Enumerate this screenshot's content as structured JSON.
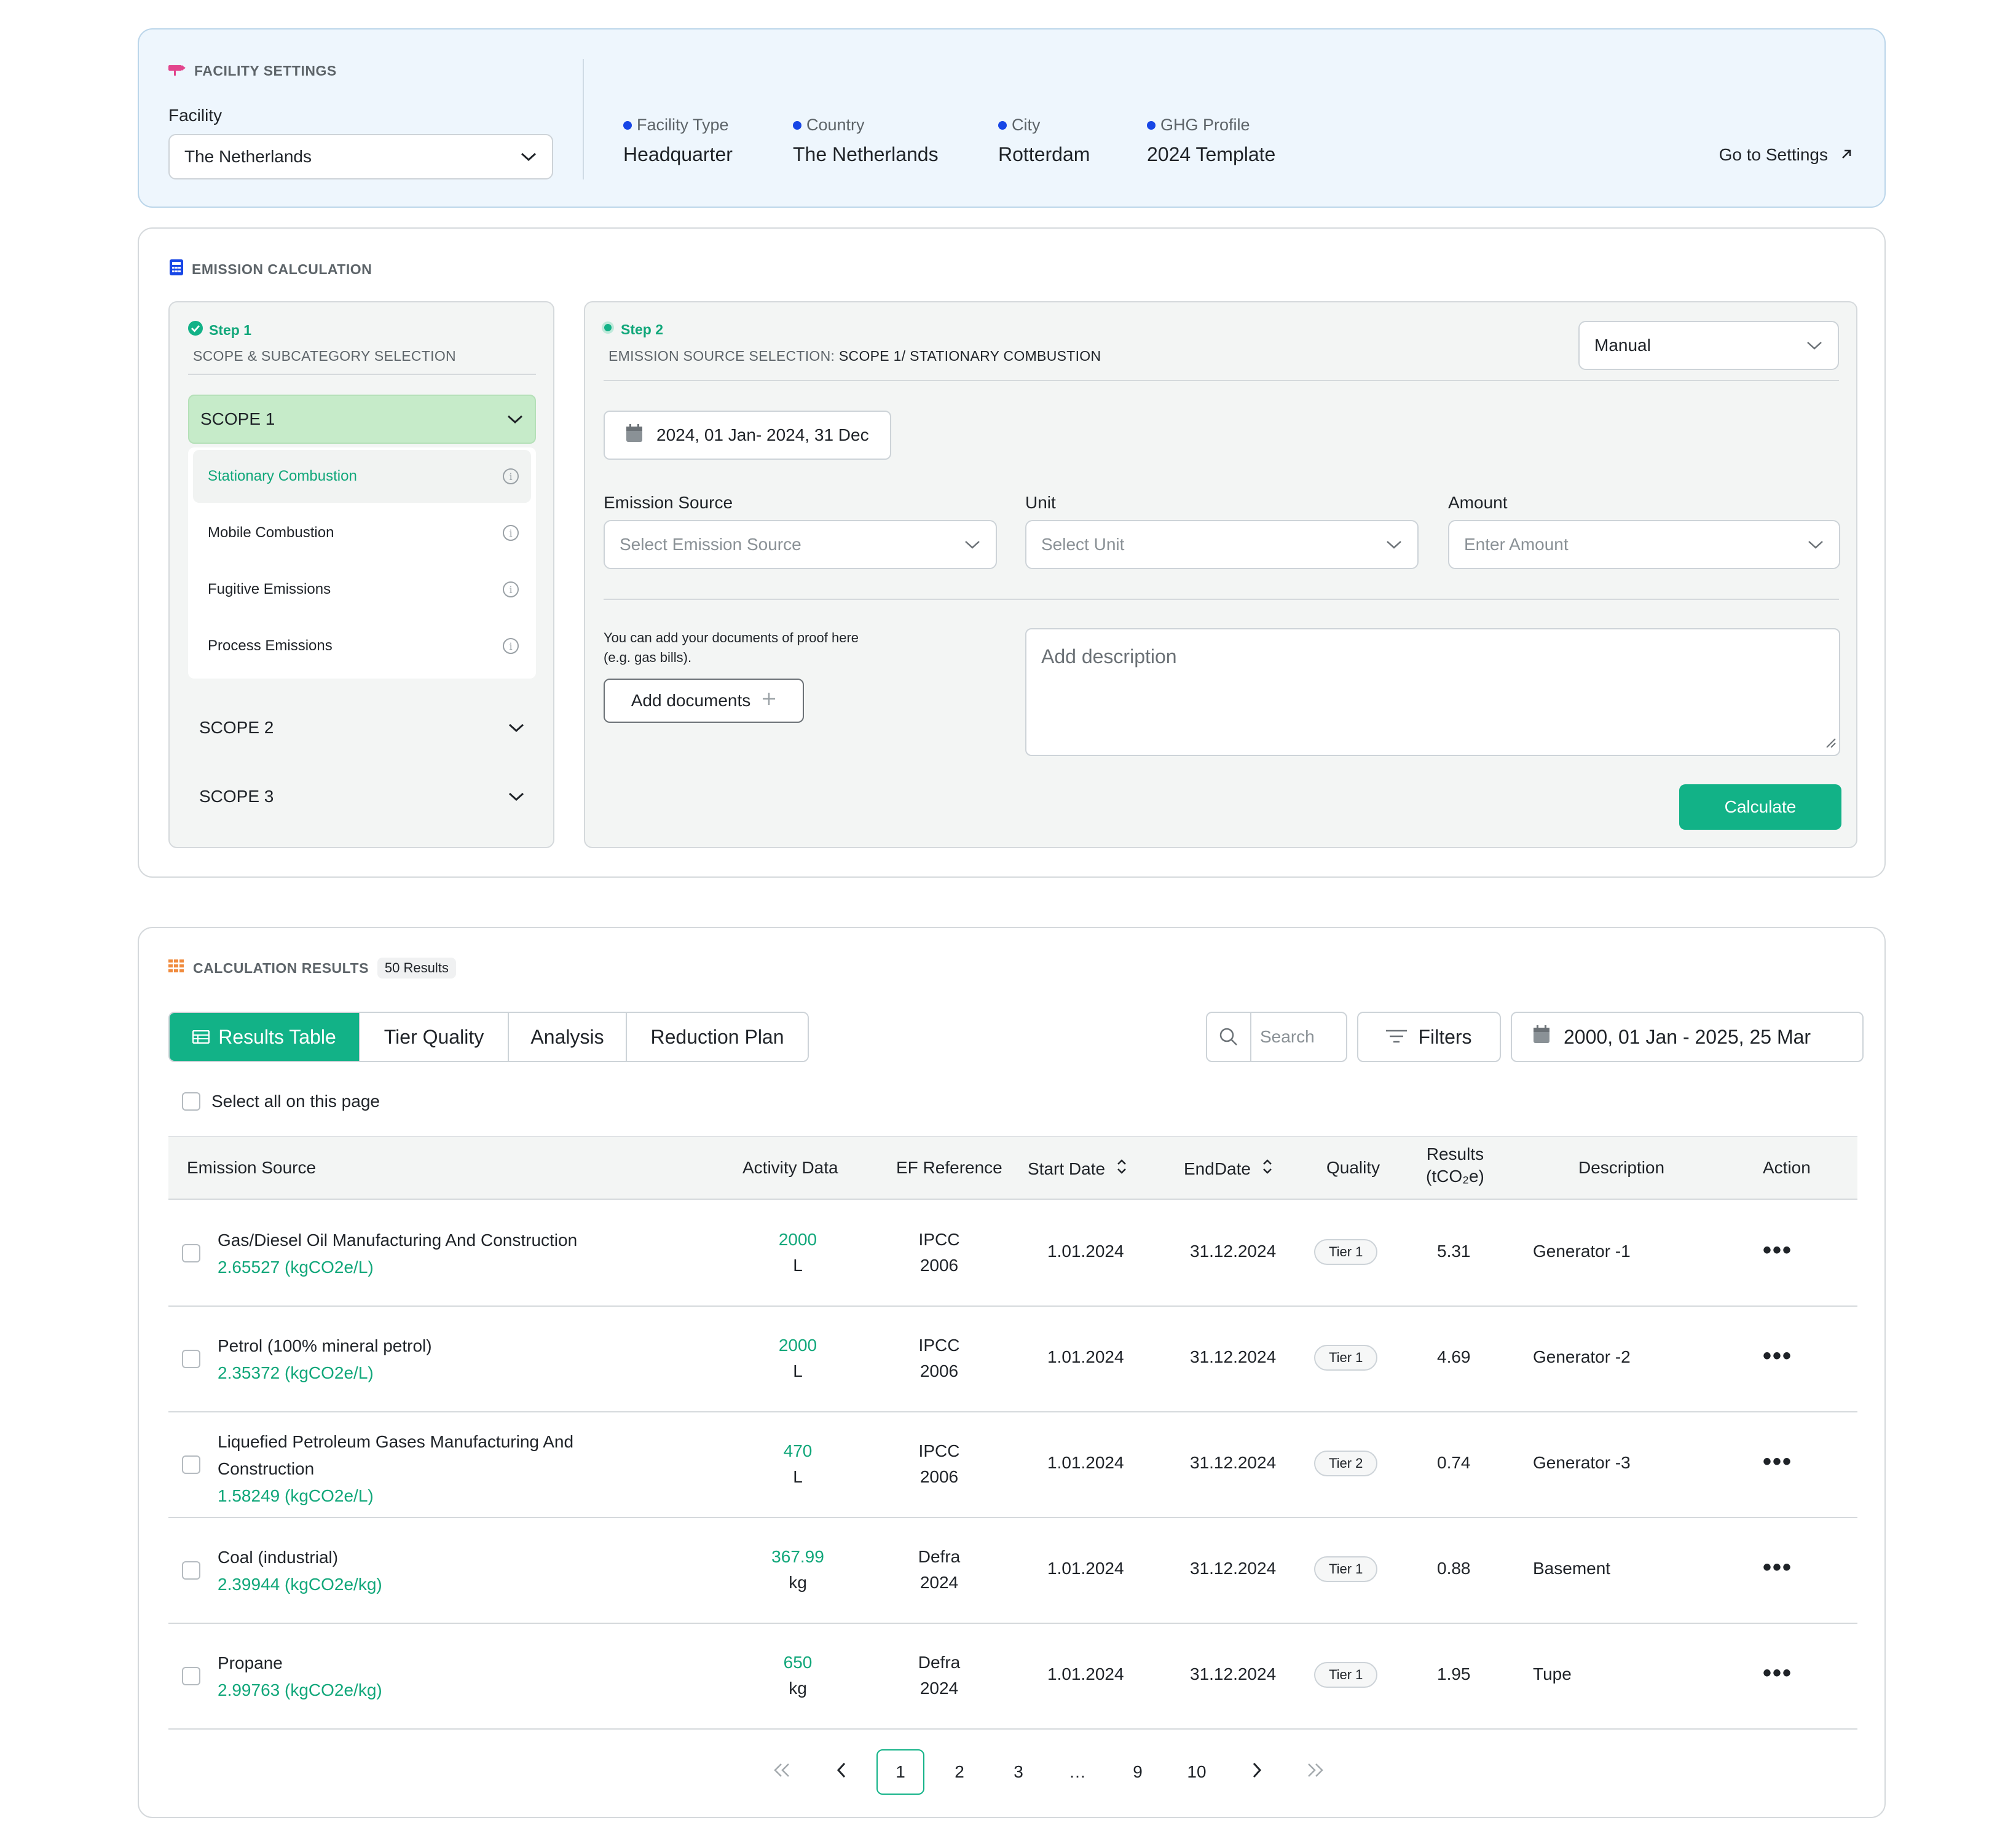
{
  "facility": {
    "section_title": "FACILITY SETTINGS",
    "facility_label": "Facility",
    "facility_value": "The Netherlands",
    "info": [
      {
        "label": "Facility Type",
        "value": "Headquarter"
      },
      {
        "label": "Country",
        "value": "The Netherlands"
      },
      {
        "label": "City",
        "value": "Rotterdam"
      },
      {
        "label": "GHG Profile",
        "value": "2024 Template"
      }
    ],
    "go_settings": "Go to Settings"
  },
  "calculation": {
    "section_title": "EMISSION CALCULATION",
    "step1": {
      "title": "Step 1",
      "subtitle": "SCOPE & SUBCATEGORY SELECTION",
      "scopes": [
        "SCOPE 1",
        "SCOPE 2",
        "SCOPE 3"
      ],
      "subcategories": [
        "Stationary Combustion",
        "Mobile Combustion",
        "Fugitive Emissions",
        "Process Emissions"
      ]
    },
    "step2": {
      "title": "Step 2",
      "subtitle_prefix": "EMISSION SOURCE SELECTION:",
      "subtitle_value": "SCOPE 1/ STATIONARY COMBUSTION",
      "mode": "Manual",
      "date_range": "2024, 01 Jan- 2024, 31 Dec",
      "emission_source_label": "Emission Source",
      "emission_source_placeholder": "Select Emission Source",
      "unit_label": "Unit",
      "unit_placeholder": "Select Unit",
      "amount_label": "Amount",
      "amount_placeholder": "Enter Amount",
      "docs_help_line1": "You can add your documents of proof here",
      "docs_help_line2": "(e.g. gas bills).",
      "add_documents": "Add documents",
      "description_placeholder": "Add description",
      "calculate": "Calculate"
    }
  },
  "results": {
    "section_title": "CALCULATION RESULTS",
    "count": "50 Results",
    "tabs": [
      "Results Table",
      "Tier Quality",
      "Analysis",
      "Reduction Plan"
    ],
    "search_placeholder": "Search",
    "filters": "Filters",
    "date_range": "2000, 01 Jan - 2025, 25 Mar",
    "select_all": "Select all on this page",
    "columns": {
      "source": "Emission Source",
      "activity": "Activity Data",
      "ef": "EF Reference",
      "start": "Start Date",
      "end": "EndDate",
      "quality": "Quality",
      "results_line1": "Results",
      "results_line2": "(tCO₂e)",
      "description": "Description",
      "action": "Action"
    },
    "rows": [
      {
        "source_line1": "Gas/Diesel Oil Manufacturing And Construction",
        "source_line2": "",
        "factor": "2.65527 (kgCO2e/L)",
        "amount": "2000",
        "unit": "L",
        "ef_line1": "IPCC",
        "ef_line2": "2006",
        "start": "1.01.2024",
        "end": "31.12.2024",
        "tier": "Tier 1",
        "result": "5.31",
        "description": "Generator -1"
      },
      {
        "source_line1": "Petrol (100% mineral petrol)",
        "source_line2": "",
        "factor": "2.35372 (kgCO2e/L)",
        "amount": "2000",
        "unit": "L",
        "ef_line1": "IPCC",
        "ef_line2": "2006",
        "start": "1.01.2024",
        "end": "31.12.2024",
        "tier": "Tier 1",
        "result": "4.69",
        "description": "Generator -2"
      },
      {
        "source_line1": "Liquefied Petroleum Gases Manufacturing And",
        "source_line2": "Construction",
        "factor": "1.58249 (kgCO2e/L)",
        "amount": "470",
        "unit": "L",
        "ef_line1": "IPCC",
        "ef_line2": "2006",
        "start": "1.01.2024",
        "end": "31.12.2024",
        "tier": "Tier 2",
        "result": "0.74",
        "description": "Generator -3"
      },
      {
        "source_line1": "Coal (industrial)",
        "source_line2": "",
        "factor": "2.39944 (kgCO2e/kg)",
        "amount": "367.99",
        "unit": "kg",
        "ef_line1": "Defra",
        "ef_line2": "2024",
        "start": "1.01.2024",
        "end": "31.12.2024",
        "tier": "Tier 1",
        "result": "0.88",
        "description": "Basement"
      },
      {
        "source_line1": "Propane",
        "source_line2": "",
        "factor": "2.99763 (kgCO2e/kg)",
        "amount": "650",
        "unit": "kg",
        "ef_line1": "Defra",
        "ef_line2": "2024",
        "start": "1.01.2024",
        "end": "31.12.2024",
        "tier": "Tier 1",
        "result": "1.95",
        "description": "Tupe"
      }
    ],
    "pagination": {
      "pages": [
        "1",
        "2",
        "3",
        "…",
        "9",
        "10"
      ],
      "current": "1"
    }
  },
  "colors": {
    "accent": "#12b287",
    "blue_dot": "#1746e6",
    "facility_bg": "#eef6fd",
    "scope_active": "#c6ebc9"
  }
}
